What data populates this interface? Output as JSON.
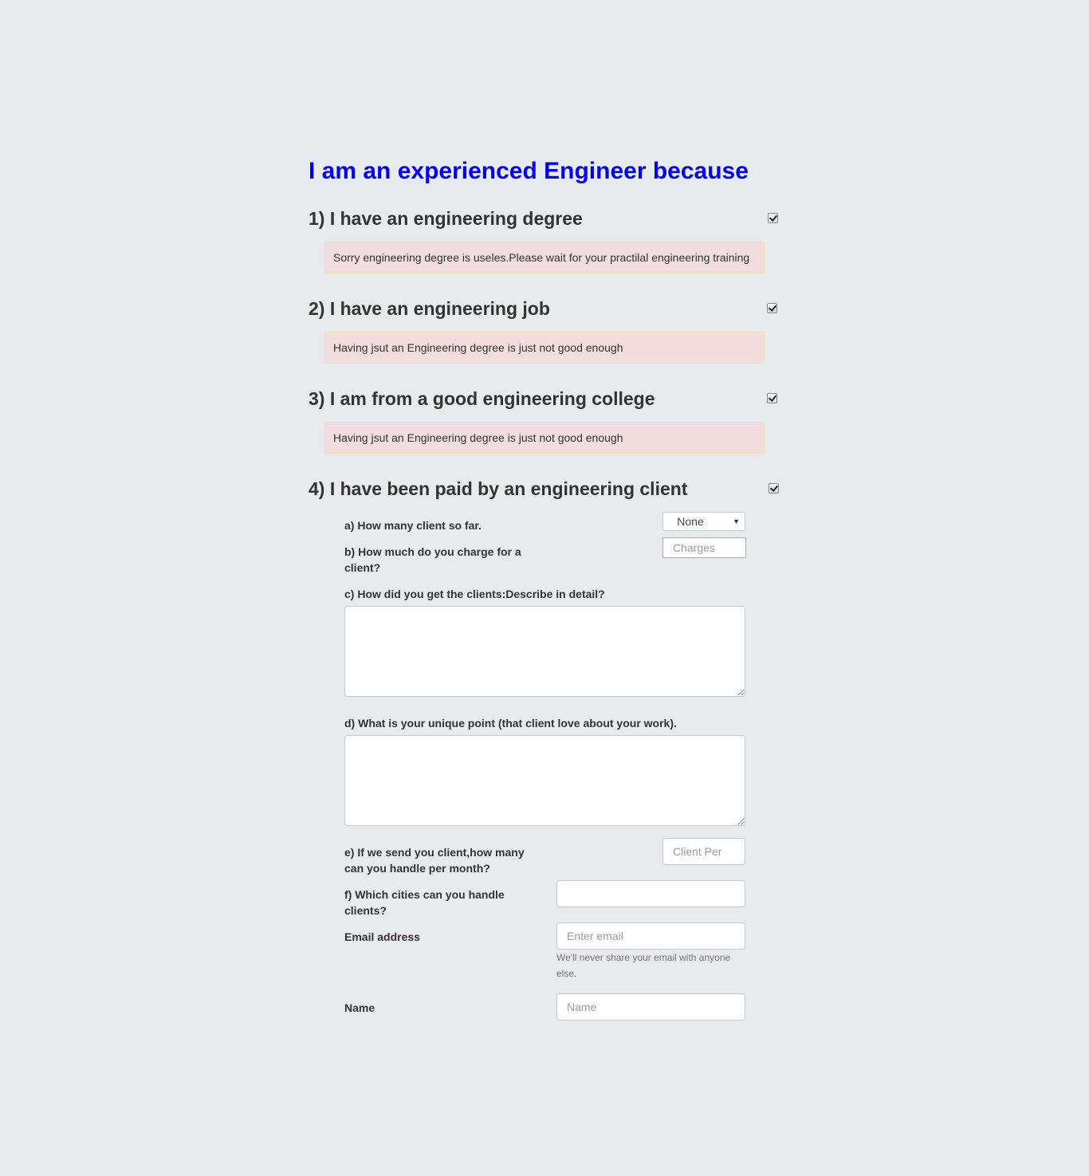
{
  "page": {
    "title": "I am an experienced Engineer because"
  },
  "questions": [
    {
      "heading": "1) I have an engineering degree",
      "checked": true,
      "message": "Sorry engineering degree is useles.Please wait for your practilal engineering training"
    },
    {
      "heading": "2) I have an engineering job",
      "checked": true,
      "message": "Having jsut an Engineering degree is just not good enough"
    },
    {
      "heading": "3) I am from a good engineering college",
      "checked": true,
      "message": "Having jsut an Engineering degree is just not good enough"
    },
    {
      "heading": "4) I have been paid by an engineering client",
      "checked": true
    }
  ],
  "client_form": {
    "a": {
      "label": "a) How many client so far.",
      "selected": "None"
    },
    "b": {
      "label": "b) How much do you charge for a client?",
      "placeholder": "Charges"
    },
    "c": {
      "label": "c) How did you get the clients:Describe in detail?",
      "value": ""
    },
    "d": {
      "label": "d) What is your unique point (that client love about your work).",
      "value": ""
    },
    "e": {
      "label": "e) If we send you client,how many can you handle per month?",
      "placeholder": "Client Per"
    },
    "f": {
      "label": "f) Which cities can you handle clients?",
      "value": ""
    },
    "email": {
      "label": "Email address",
      "placeholder": "Enter email",
      "help": "We'll never share your email with anyone else."
    },
    "name": {
      "label": "Name",
      "placeholder": "Name"
    }
  },
  "icons": {
    "checkbox": "checkbox-checked-icon",
    "select_caret": "caret-down-icon"
  },
  "colors": {
    "background": "#e8ebee",
    "title": "#0000ee",
    "alert_background": "#f2dede",
    "alert_border": "#f5d9b0"
  }
}
